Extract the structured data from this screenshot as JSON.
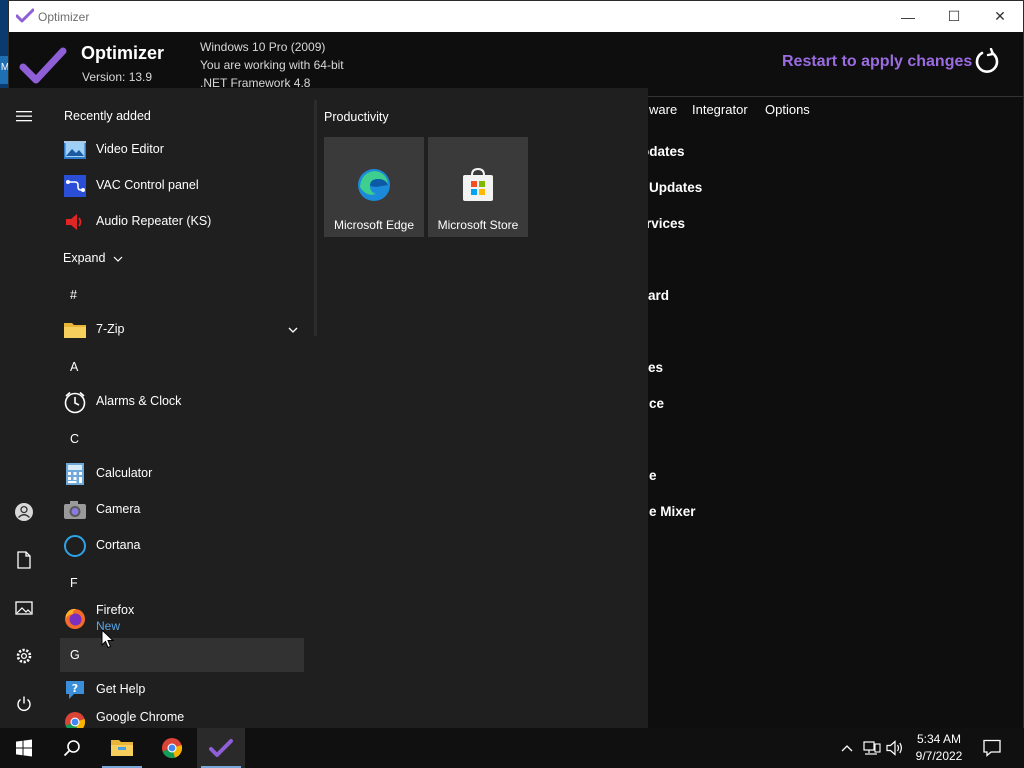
{
  "desktop": {
    "edge_label": "M"
  },
  "window": {
    "title": "Optimizer",
    "controls": {
      "minimize": "—",
      "maximize": "☐",
      "close": "✕"
    }
  },
  "app": {
    "name": "Optimizer",
    "version": "Version: 13.9",
    "sys_info": [
      "Windows 10 Pro (2009)",
      "You are working with 64-bit",
      ".NET Framework 4.8"
    ],
    "restart_label": "Restart to apply changes",
    "tabs": [
      "ware",
      "Integrator",
      "Options"
    ],
    "items": [
      "odates",
      "Updates",
      "rvices",
      "ard",
      "es",
      "ce",
      "e",
      "e Mixer"
    ],
    "accent": "#9b6ce0"
  },
  "start_menu": {
    "recently_added_title": "Recently added",
    "recent": [
      {
        "label": "Video Editor",
        "icon": "video-editor-icon"
      },
      {
        "label": "VAC Control panel",
        "icon": "vac-control-icon"
      },
      {
        "label": "Audio Repeater (KS)",
        "icon": "audio-repeater-icon"
      }
    ],
    "expand_label": "Expand",
    "sections": [
      {
        "letter": "#",
        "apps": [
          {
            "label": "7-Zip",
            "icon": "folder-icon",
            "has_chevron": true
          }
        ]
      },
      {
        "letter": "A",
        "apps": [
          {
            "label": "Alarms & Clock",
            "icon": "alarm-clock-icon"
          }
        ]
      },
      {
        "letter": "C",
        "apps": [
          {
            "label": "Calculator",
            "icon": "calculator-icon"
          },
          {
            "label": "Camera",
            "icon": "camera-icon"
          },
          {
            "label": "Cortana",
            "icon": "cortana-icon"
          }
        ]
      },
      {
        "letter": "F",
        "apps": [
          {
            "label": "Firefox",
            "sub": "New",
            "icon": "firefox-icon"
          }
        ]
      },
      {
        "letter": "G",
        "apps": [
          {
            "label": "Get Help",
            "icon": "get-help-icon"
          },
          {
            "label": "Google Chrome",
            "icon": "chrome-icon"
          }
        ]
      }
    ],
    "tiles_group": "Productivity",
    "tiles": [
      {
        "label": "Microsoft Edge",
        "icon": "edge-icon"
      },
      {
        "label": "Microsoft Store",
        "icon": "store-icon"
      }
    ],
    "rail": [
      "user-icon",
      "documents-icon",
      "pictures-icon",
      "settings-icon",
      "power-icon"
    ]
  },
  "taskbar": {
    "apps": [
      "start-icon",
      "search-icon",
      "file-explorer-icon",
      "chrome-icon",
      "optimizer-icon"
    ],
    "time": "5:34 AM",
    "date": "9/7/2022"
  }
}
